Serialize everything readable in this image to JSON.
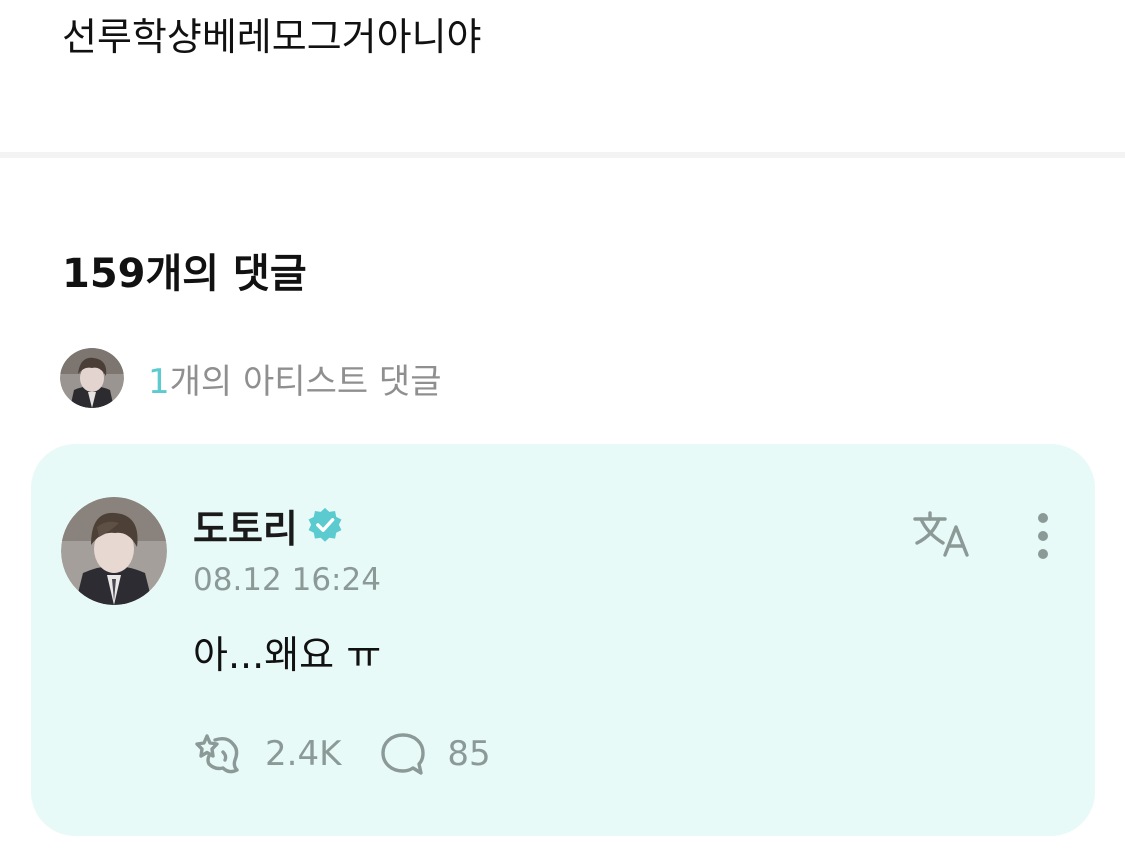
{
  "post": {
    "text": "선루학샹베레모그거아니야"
  },
  "comments_header": {
    "title": "159개의 댓글"
  },
  "artist_comments": {
    "count": "1",
    "label": "개의 아티스트 댓글"
  },
  "comment": {
    "author": "도토리",
    "verified_icon": "verified-badge-icon",
    "timestamp": "08.12 16:24",
    "body": "아...왜요 ㅠ",
    "like_count": "2.4K",
    "reply_count": "85"
  },
  "colors": {
    "accent": "#5ccbcf",
    "card_background": "#e8faf7",
    "muted_text": "#8c9a97"
  }
}
